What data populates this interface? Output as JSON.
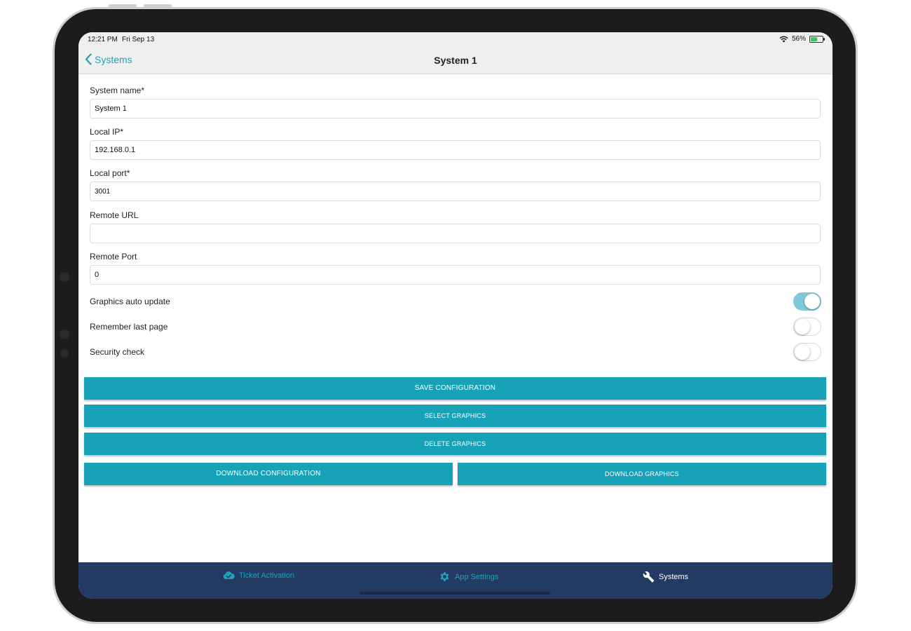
{
  "status": {
    "time": "12:21 PM",
    "date": "Fri Sep 13",
    "battery": "56%",
    "battery_level": 0.56
  },
  "nav": {
    "back_label": "Systems",
    "title": "System 1"
  },
  "form": {
    "system_name": {
      "label": "System name*",
      "value": "System 1"
    },
    "local_ip": {
      "label": "Local IP*",
      "value": "192.168.0.1"
    },
    "local_port": {
      "label": "Local port*",
      "value": "3001"
    },
    "remote_url": {
      "label": "Remote URL",
      "value": ""
    },
    "remote_port": {
      "label": "Remote Port",
      "value": "0"
    }
  },
  "toggles": {
    "graphics_auto_update": {
      "label": "Graphics auto update",
      "on": true
    },
    "remember_last_page": {
      "label": "Remember last page",
      "on": false
    },
    "security_check": {
      "label": "Security check",
      "on": false
    }
  },
  "buttons": {
    "save": "SAVE CONFIGURATION",
    "select_graphics": "SELECT GRAPHICS",
    "delete_graphics": "DELETE GRAPHICS",
    "download_config": "DOWNLOAD CONFIGURATION",
    "download_graphics": "DOWNLOAD GRAPHICS"
  },
  "tabs": [
    {
      "label": "Ticket Activation",
      "icon": "cloud-check-icon",
      "active": false
    },
    {
      "label": "App Settings",
      "icon": "gear-icon",
      "active": false
    },
    {
      "label": "Systems",
      "icon": "wrench-icon",
      "active": true
    }
  ],
  "colors": {
    "accent": "#17a2b8",
    "tabbar": "#233a63",
    "toggle_on": "#7fcad6"
  }
}
